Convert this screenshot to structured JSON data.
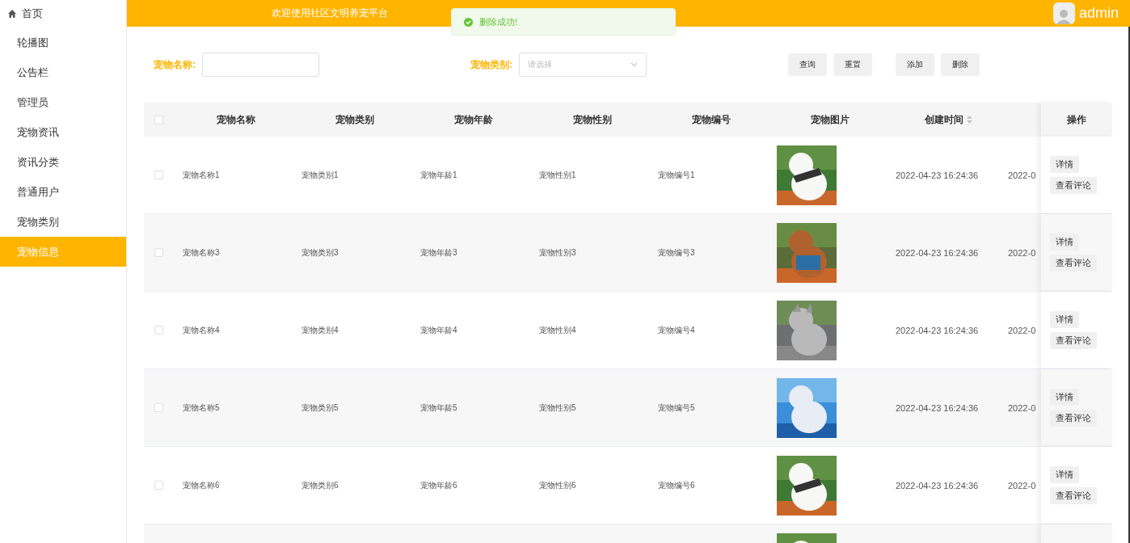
{
  "sidebar": {
    "items": [
      {
        "label": "首页",
        "selected": false
      },
      {
        "label": "轮播图",
        "selected": false
      },
      {
        "label": "公告栏",
        "selected": false
      },
      {
        "label": "管理员",
        "selected": false
      },
      {
        "label": "宠物资讯",
        "selected": false
      },
      {
        "label": "资讯分类",
        "selected": false
      },
      {
        "label": "普通用户",
        "selected": false
      },
      {
        "label": "宠物类别",
        "selected": false
      },
      {
        "label": "宠物信息",
        "selected": true
      }
    ]
  },
  "header": {
    "title": "欢迎使用社区文明养宠平台",
    "user": "admin"
  },
  "toast": {
    "message": "删除成功!"
  },
  "search": {
    "fields": [
      {
        "label": "宠物名称:",
        "kind": "text"
      },
      {
        "label": "宠物类别:",
        "kind": "select",
        "placeholder": "请选择"
      }
    ],
    "button_groups": [
      [
        "查询",
        "重置"
      ],
      [
        "添加",
        "删除"
      ]
    ]
  },
  "table": {
    "all_checked": false,
    "columns": [
      {
        "label": "宠物名称",
        "sortable": false
      },
      {
        "label": "宠物类别",
        "sortable": false
      },
      {
        "label": "宠物年龄",
        "sortable": false
      },
      {
        "label": "宠物性别",
        "sortable": false
      },
      {
        "label": "宠物编号",
        "sortable": false
      },
      {
        "label": "宠物图片",
        "sortable": false
      },
      {
        "label": "创建时间",
        "sortable": true
      }
    ],
    "action_header": "操作",
    "rows": [
      {
        "checked": false,
        "cells": [
          "宠物名称1",
          "宠物类别1",
          "宠物年龄1",
          "宠物性别1",
          "宠物编号1"
        ],
        "image": {
          "kind": "picture"
        },
        "created": "2022-04-23 16:24:36",
        "column_8": "2022-0",
        "actions": [
          "详情",
          "查看评论"
        ]
      },
      {
        "checked": false,
        "cells": [
          "宠物名称3",
          "宠物类别3",
          "宠物年龄3",
          "宠物性别3",
          "宠物编号3"
        ],
        "image": {
          "kind": "picture"
        },
        "created": "2022-04-23 16:24:36",
        "column_8": "2022-0",
        "actions": [
          "详情",
          "查看评论"
        ]
      },
      {
        "checked": false,
        "cells": [
          "宠物名称4",
          "宠物类别4",
          "宠物年龄4",
          "宠物性别4",
          "宠物编号4"
        ],
        "image": {
          "kind": "picture"
        },
        "created": "2022-04-23 16:24:36",
        "column_8": "2022-0",
        "actions": [
          "详情",
          "查看评论"
        ]
      },
      {
        "checked": false,
        "cells": [
          "宠物名称5",
          "宠物类别5",
          "宠物年龄5",
          "宠物性别5",
          "宠物编号5"
        ],
        "image": {
          "kind": "picture"
        },
        "created": "2022-04-23 16:24:36",
        "column_8": "2022-0",
        "actions": [
          "详情",
          "查看评论"
        ]
      },
      {
        "checked": false,
        "cells": [
          "宠物名称6",
          "宠物类别6",
          "宠物年龄6",
          "宠物性别6",
          "宠物编号6"
        ],
        "image": {
          "kind": "picture"
        },
        "created": "2022-04-23 16:24:36",
        "column_8": "2022-0",
        "actions": [
          "详情",
          "查看评论"
        ]
      },
      {
        "image": {
          "kind": "picture"
        }
      }
    ]
  }
}
